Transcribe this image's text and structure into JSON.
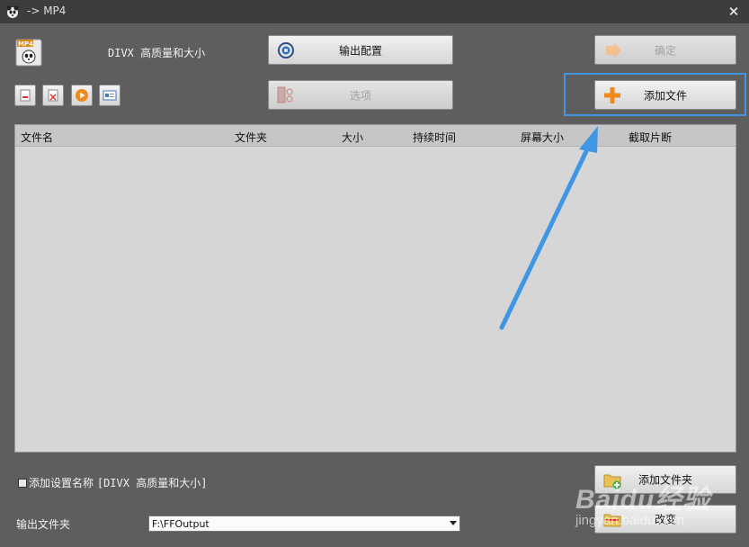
{
  "window": {
    "title": "-> MP4",
    "close_glyph": "✕"
  },
  "toolbar": {
    "profile_label": "DIVX 高质量和大小",
    "output_config_label": "输出配置",
    "options_label": "选项",
    "ok_label": "确定",
    "add_file_label": "添加文件"
  },
  "file_list": {
    "columns": [
      "文件名",
      "文件夹",
      "大小",
      "持续时间",
      "屏幕大小",
      "截取片断"
    ]
  },
  "bottom": {
    "add_profile_name_label": "添加设置名称",
    "add_profile_name_suffix": "[DIVX 高质量和大小]",
    "add_profile_name_checked": false,
    "add_folder_label": "添加文件夹",
    "change_label": "改变",
    "output_folder_label": "输出文件夹",
    "output_folder_value": "F:\\FFOutput"
  },
  "watermark": {
    "brand": "Baidu经验",
    "url": "jingyan.baidu.com"
  },
  "icons": {
    "app": "panda-icon",
    "logo": "mp4-format-icon",
    "output_config": "gear-icon",
    "options": "film-scissors-icon",
    "ok": "arrow-right-icon",
    "add_file": "plus-icon",
    "add_folder": "folder-add-icon",
    "change": "folder-icon"
  },
  "colors": {
    "highlight": "#3f97e3",
    "accent_orange": "#f08a1c"
  }
}
